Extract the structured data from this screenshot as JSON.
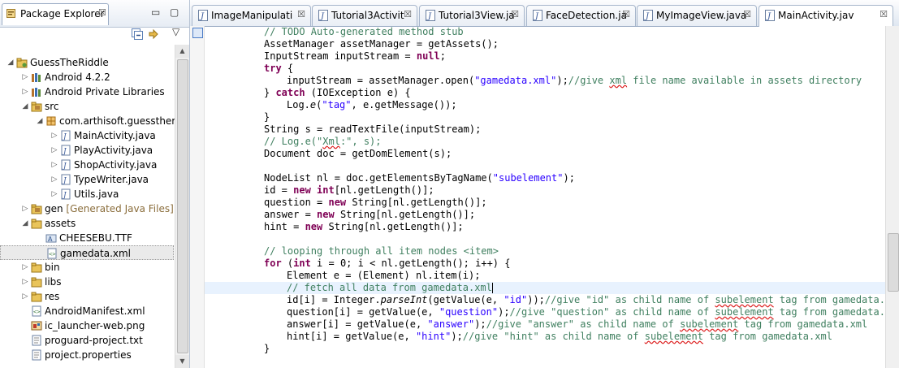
{
  "package_explorer": {
    "title": "Package Explorer",
    "close": "☒",
    "minimize": "▭",
    "maximize": "▢",
    "menu": "▽",
    "tree": [
      {
        "label": "GuessTheRiddle",
        "icon": "project-icon",
        "twisty": "◢"
      },
      {
        "label": "Android 4.2.2",
        "icon": "library-icon",
        "twisty": "▷"
      },
      {
        "label": "Android Private Libraries",
        "icon": "library-icon",
        "twisty": "▷"
      },
      {
        "label": "src",
        "icon": "source-folder-icon",
        "twisty": "◢"
      },
      {
        "label": "com.arthisoft.guesstheri",
        "icon": "package-icon",
        "twisty": "◢"
      },
      {
        "label": "MainActivity.java",
        "icon": "java-file-icon",
        "twisty": "▷"
      },
      {
        "label": "PlayActivity.java",
        "icon": "java-file-icon",
        "twisty": "▷"
      },
      {
        "label": "ShopActivity.java",
        "icon": "java-file-icon",
        "twisty": "▷"
      },
      {
        "label": "TypeWriter.java",
        "icon": "java-file-icon",
        "twisty": "▷"
      },
      {
        "label": "Utils.java",
        "icon": "java-file-icon",
        "twisty": "▷"
      },
      {
        "label": "gen",
        "decoration": "[Generated Java Files]",
        "icon": "source-folder-icon",
        "twisty": "▷"
      },
      {
        "label": "assets",
        "icon": "folder-icon",
        "twisty": "◢"
      },
      {
        "label": "CHEESEBU.TTF",
        "icon": "font-file-icon",
        "twisty": ""
      },
      {
        "label": "gamedata.xml",
        "icon": "xml-file-icon",
        "twisty": ""
      },
      {
        "label": "bin",
        "icon": "folder-icon",
        "twisty": "▷"
      },
      {
        "label": "libs",
        "icon": "folder-icon",
        "twisty": "▷"
      },
      {
        "label": "res",
        "icon": "folder-icon",
        "twisty": "▷"
      },
      {
        "label": "AndroidManifest.xml",
        "icon": "xml-file-icon",
        "twisty": ""
      },
      {
        "label": "ic_launcher-web.png",
        "icon": "image-file-icon",
        "twisty": ""
      },
      {
        "label": "proguard-project.txt",
        "icon": "text-file-icon",
        "twisty": ""
      },
      {
        "label": "project.properties",
        "icon": "text-file-icon",
        "twisty": ""
      }
    ]
  },
  "editor": {
    "tabs": [
      {
        "label": "ImageManipulati",
        "active": false
      },
      {
        "label": "Tutorial3Activit",
        "active": false
      },
      {
        "label": "Tutorial3View.ja",
        "active": false
      },
      {
        "label": "FaceDetection.ja",
        "active": false
      },
      {
        "label": "MyImageView.java",
        "active": false
      },
      {
        "label": "MainActivity.jav",
        "active": true
      }
    ],
    "tab_close": "☒",
    "code_lines": [
      {
        "indent": 2,
        "segs": [
          [
            "cm",
            "// TODO Auto-generated method stub"
          ]
        ]
      },
      {
        "indent": 2,
        "segs": [
          [
            "",
            "AssetManager assetManager = getAssets();"
          ]
        ]
      },
      {
        "indent": 2,
        "segs": [
          [
            "",
            "InputStream inputStream = "
          ],
          [
            "kw",
            "null"
          ],
          [
            "",
            ";"
          ]
        ]
      },
      {
        "indent": 2,
        "segs": [
          [
            "kw",
            "try"
          ],
          [
            "",
            " {"
          ]
        ]
      },
      {
        "indent": 3,
        "segs": [
          [
            "",
            "inputStream = assetManager.open("
          ],
          [
            "st",
            "\"gamedata.xml\""
          ],
          [
            "",
            ");"
          ],
          [
            "cm",
            "//give "
          ],
          [
            "cm sq",
            "xml"
          ],
          [
            "cm",
            " file name available in assets directory"
          ]
        ]
      },
      {
        "indent": 2,
        "segs": [
          [
            "",
            "} "
          ],
          [
            "kw",
            "catch"
          ],
          [
            "",
            " (IOException e) {"
          ]
        ]
      },
      {
        "indent": 3,
        "segs": [
          [
            "",
            "Log."
          ],
          [
            "it",
            "e"
          ],
          [
            "",
            "("
          ],
          [
            "st",
            "\"tag\""
          ],
          [
            "",
            ", e.getMessage());"
          ]
        ]
      },
      {
        "indent": 2,
        "segs": [
          [
            "",
            "}"
          ]
        ]
      },
      {
        "indent": 2,
        "segs": [
          [
            "",
            "String s = readTextFile(inputStream);"
          ]
        ]
      },
      {
        "indent": 2,
        "segs": [
          [
            "cm",
            "// Log.e(\""
          ],
          [
            "cm sq",
            "Xml"
          ],
          [
            "cm",
            ":\", s);"
          ]
        ]
      },
      {
        "indent": 2,
        "segs": [
          [
            "",
            "Document doc = getDomElement(s);"
          ]
        ]
      },
      {
        "indent": 0,
        "segs": []
      },
      {
        "indent": 2,
        "segs": [
          [
            "",
            "NodeList nl = doc.getElementsByTagName("
          ],
          [
            "st",
            "\"subelement\""
          ],
          [
            "",
            ");"
          ]
        ]
      },
      {
        "indent": 2,
        "segs": [
          [
            "",
            "id = "
          ],
          [
            "kw",
            "new"
          ],
          [
            "",
            " "
          ],
          [
            "kw",
            "int"
          ],
          [
            "",
            "[nl.getLength()];"
          ]
        ]
      },
      {
        "indent": 2,
        "segs": [
          [
            "",
            "question = "
          ],
          [
            "kw",
            "new"
          ],
          [
            "",
            " String[nl.getLength()];"
          ]
        ]
      },
      {
        "indent": 2,
        "segs": [
          [
            "",
            "answer = "
          ],
          [
            "kw",
            "new"
          ],
          [
            "",
            " String[nl.getLength()];"
          ]
        ]
      },
      {
        "indent": 2,
        "segs": [
          [
            "",
            "hint = "
          ],
          [
            "kw",
            "new"
          ],
          [
            "",
            " String[nl.getLength()];"
          ]
        ]
      },
      {
        "indent": 0,
        "segs": []
      },
      {
        "indent": 2,
        "segs": [
          [
            "cm",
            "// looping through all item nodes <item>"
          ]
        ]
      },
      {
        "indent": 2,
        "segs": [
          [
            "kw",
            "for"
          ],
          [
            "",
            " ("
          ],
          [
            "kw",
            "int"
          ],
          [
            "",
            " i = 0; i < nl.getLength(); i++) {"
          ]
        ]
      },
      {
        "indent": 3,
        "segs": [
          [
            "",
            "Element e = (Element) nl.item(i);"
          ]
        ]
      },
      {
        "indent": 3,
        "current": true,
        "segs": [
          [
            "cm",
            "// fetch all data from gamedata.xml"
          ]
        ]
      },
      {
        "indent": 3,
        "segs": [
          [
            "",
            "id[i] = Integer."
          ],
          [
            "it",
            "parseInt"
          ],
          [
            "",
            "(getValue(e, "
          ],
          [
            "st",
            "\"id\""
          ],
          [
            "",
            "));"
          ],
          [
            "cm",
            "//give \"id\" as child name of "
          ],
          [
            "cm sq",
            "subelement"
          ],
          [
            "cm",
            " tag from gamedata.xml"
          ]
        ]
      },
      {
        "indent": 3,
        "segs": [
          [
            "",
            "question[i] = getValue(e, "
          ],
          [
            "st",
            "\"question\""
          ],
          [
            "",
            ");"
          ],
          [
            "cm",
            "//give \"question\" as child name of "
          ],
          [
            "cm sq",
            "subelement"
          ],
          [
            "cm",
            " tag from gamedata.xml"
          ]
        ]
      },
      {
        "indent": 3,
        "segs": [
          [
            "",
            "answer[i] = getValue(e, "
          ],
          [
            "st",
            "\"answer\""
          ],
          [
            "",
            ");"
          ],
          [
            "cm",
            "//give \"answer\" as child name of "
          ],
          [
            "cm sq",
            "subelement"
          ],
          [
            "cm",
            " tag from gamedata.xml"
          ]
        ]
      },
      {
        "indent": 3,
        "segs": [
          [
            "",
            "hint[i] = getValue(e, "
          ],
          [
            "st",
            "\"hint\""
          ],
          [
            "",
            ");"
          ],
          [
            "cm",
            "//give \"hint\" as child name of "
          ],
          [
            "cm sq",
            "subelement"
          ],
          [
            "cm",
            " tag from gamedata.xml"
          ]
        ]
      },
      {
        "indent": 2,
        "segs": [
          [
            "",
            "}"
          ]
        ]
      }
    ]
  },
  "colors": {
    "keyword": "#7f0055",
    "comment": "#3f7f5f",
    "string": "#2a00ff",
    "current_line": "#e8f2fe"
  }
}
